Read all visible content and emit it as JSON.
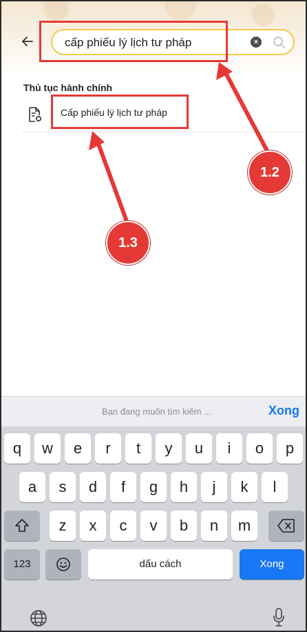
{
  "search": {
    "value": "cấp phiếu lý lịch tư pháp"
  },
  "results": {
    "section_title": "Thủ tục hành chính",
    "items": [
      {
        "label": "Cấp phiếu lý lịch tư pháp"
      }
    ]
  },
  "annotations": {
    "step_search": "1.2",
    "step_result": "1.3",
    "color": "#e53935"
  },
  "keyboard": {
    "suggestion_placeholder": "Bạn đang muốn tìm kiếm ...",
    "done_label": "Xong",
    "row1": [
      "q",
      "w",
      "e",
      "r",
      "t",
      "y",
      "u",
      "i",
      "o",
      "p"
    ],
    "row2": [
      "a",
      "s",
      "d",
      "f",
      "g",
      "h",
      "j",
      "k",
      "l"
    ],
    "row3": [
      "z",
      "x",
      "c",
      "v",
      "b",
      "n",
      "m"
    ],
    "numbers_label": "123",
    "space_label": "dấu cách",
    "return_label": "Xong"
  },
  "colors": {
    "accent": "#1877f2",
    "search_border": "#f2c94c"
  },
  "icons": [
    "back-arrow-icon",
    "clear-icon",
    "search-icon",
    "document-icon",
    "shift-icon",
    "backspace-icon",
    "emoji-icon",
    "globe-icon",
    "microphone-icon"
  ]
}
